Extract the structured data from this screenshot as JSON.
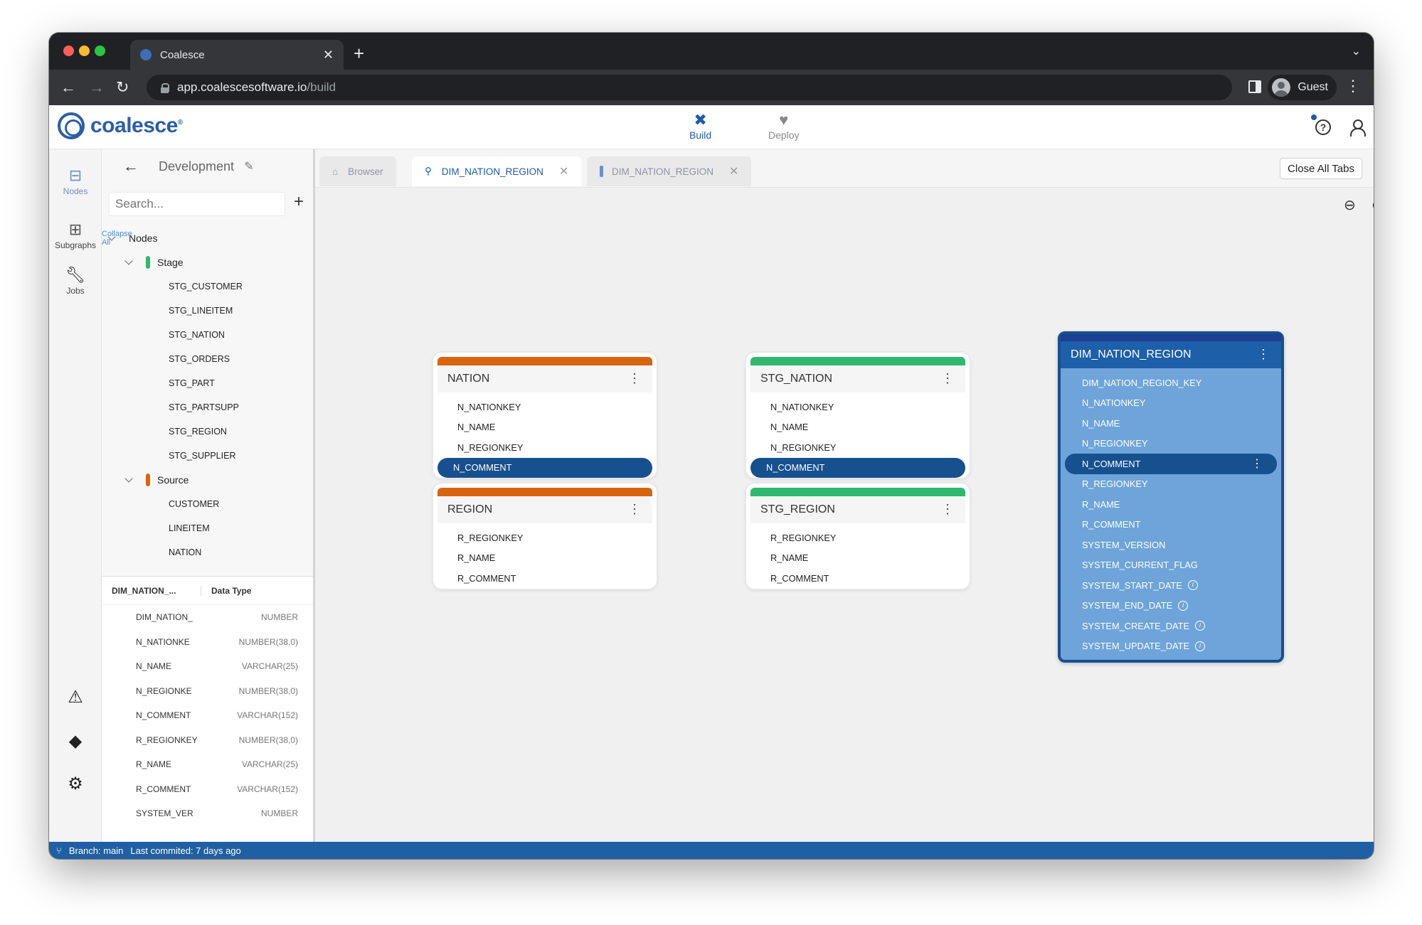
{
  "browser": {
    "tab_title": "Coalesce",
    "url_host": "app.coalescesoftware.io",
    "url_path": "/build",
    "profile_label": "Guest"
  },
  "app": {
    "logo_text": "coalesce",
    "modes": [
      {
        "label": "Build",
        "icon": "tools-icon",
        "active": true
      },
      {
        "label": "Deploy",
        "icon": "deploy-icon",
        "active": false
      }
    ]
  },
  "rail": {
    "nodes_label": "Nodes",
    "subgraphs_label": "Subgraphs",
    "jobs_label": "Jobs"
  },
  "sidebar": {
    "workspace": "Development",
    "search_placeholder": "Search...",
    "tree_root": "Nodes",
    "collapse_all": "Collapse All",
    "stage_group": "Stage",
    "stage_color": "#2fb86e",
    "stage_items": [
      "STG_CUSTOMER",
      "STG_LINEITEM",
      "STG_NATION",
      "STG_ORDERS",
      "STG_PART",
      "STG_PARTSUPP",
      "STG_REGION",
      "STG_SUPPLIER"
    ],
    "source_group": "Source",
    "source_color": "#d9640f",
    "source_items": [
      "CUSTOMER",
      "LINEITEM",
      "NATION"
    ],
    "columns_header": "DIM_NATION_...",
    "datatype_header": "Data Type",
    "columns": [
      {
        "name": "DIM_NATION_",
        "type": "NUMBER"
      },
      {
        "name": "N_NATIONKE",
        "type": "NUMBER(38,0)"
      },
      {
        "name": "N_NAME",
        "type": "VARCHAR(25)"
      },
      {
        "name": "N_REGIONKE",
        "type": "NUMBER(38,0)"
      },
      {
        "name": "N_COMMENT",
        "type": "VARCHAR(152)"
      },
      {
        "name": "R_REGIONKEY",
        "type": "NUMBER(38,0)"
      },
      {
        "name": "R_NAME",
        "type": "VARCHAR(25)"
      },
      {
        "name": "R_COMMENT",
        "type": "VARCHAR(152)"
      },
      {
        "name": "SYSTEM_VER",
        "type": "NUMBER"
      }
    ]
  },
  "tabs": [
    {
      "label": "Browser",
      "active": false
    },
    {
      "label": "DIM_NATION_REGION",
      "active": true
    },
    {
      "label": "DIM_NATION_REGION",
      "active": false
    }
  ],
  "close_all_label": "Close All Tabs",
  "graph": {
    "nation": {
      "title": "NATION",
      "columns": [
        "N_NATIONKEY",
        "N_NAME",
        "N_REGIONKEY",
        "N_COMMENT"
      ],
      "selected": "N_COMMENT"
    },
    "region": {
      "title": "REGION",
      "columns": [
        "R_REGIONKEY",
        "R_NAME",
        "R_COMMENT"
      ]
    },
    "stg_nation": {
      "title": "STG_NATION",
      "columns": [
        "N_NATIONKEY",
        "N_NAME",
        "N_REGIONKEY",
        "N_COMMENT"
      ],
      "selected": "N_COMMENT"
    },
    "stg_region": {
      "title": "STG_REGION",
      "columns": [
        "R_REGIONKEY",
        "R_NAME",
        "R_COMMENT"
      ]
    },
    "dim": {
      "title": "DIM_NATION_REGION",
      "columns": [
        "DIM_NATION_REGION_KEY",
        "N_NATIONKEY",
        "N_NAME",
        "N_REGIONKEY",
        "N_COMMENT",
        "R_REGIONKEY",
        "R_NAME",
        "R_COMMENT",
        "SYSTEM_VERSION",
        "SYSTEM_CURRENT_FLAG",
        "SYSTEM_START_DATE",
        "SYSTEM_END_DATE",
        "SYSTEM_CREATE_DATE",
        "SYSTEM_UPDATE_DATE"
      ],
      "selected": "N_COMMENT",
      "info_columns": [
        "SYSTEM_START_DATE",
        "SYSTEM_END_DATE",
        "SYSTEM_CREATE_DATE",
        "SYSTEM_UPDATE_DATE"
      ]
    }
  },
  "status": {
    "branch": "Branch: main",
    "last_committed": "Last commited: 7 days ago"
  }
}
